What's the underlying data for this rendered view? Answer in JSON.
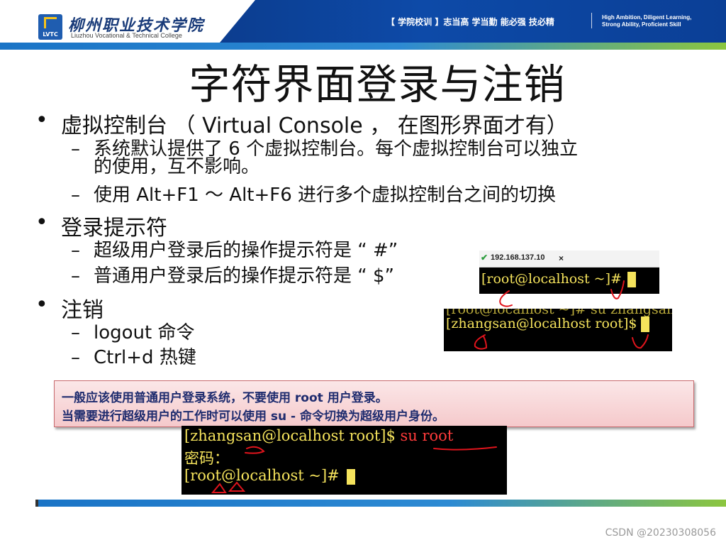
{
  "header": {
    "logo_text": "LVTC",
    "school_name_cn": "柳州职业技术学院",
    "school_name_en": "Liuzhou Vocational & Technical College",
    "motto_cn": "【 学院校训 】志当高  学当勤  能必强  技必精",
    "motto_en_line1": "High Ambition, Diligent Learning,",
    "motto_en_line2": "Strong Ability, Proficient Skill",
    "colors": {
      "banner": "#0c3d8f",
      "stripe_start": "#1a74c6",
      "stripe_end": "#8cc63f"
    }
  },
  "slide": {
    "title": "字符界面登录与注销",
    "bullets": [
      {
        "text": "虚拟控制台 （ Virtual Console ， 在图形界面才有）",
        "subs": [
          {
            "line1": "系统默认提供了 6 个虚拟控制台。每个虚拟控制台可以独立",
            "line2": "的使用，互不影响。"
          },
          {
            "line1": "使用 Alt+F1 ～ Alt+F6 进行多个虚拟控制台之间的切换"
          }
        ]
      },
      {
        "text": "登录提示符",
        "subs": [
          {
            "line1": "超级用户登录后的操作提示符是 “ #”"
          },
          {
            "line1": "普通用户登录后的操作提示符是 “ $”"
          }
        ]
      },
      {
        "text": "注销",
        "subs": [
          {
            "line1": "logout 命令"
          },
          {
            "line1": "Ctrl+d 热键"
          }
        ]
      }
    ],
    "bullet_glyph": "•",
    "dash_glyph": "–"
  },
  "terminal_tab": {
    "label": "192.168.137.10",
    "close": "×",
    "icon": "check-icon"
  },
  "terminal_root": {
    "prompt": "[root@localhost ~]#"
  },
  "terminal_user": {
    "ghost_line": "[root@localhost ~]# su zhangsan",
    "prompt": "[zhangsan@localhost root]$"
  },
  "note": {
    "line1": "一般应该使用普通用户登录系统，不要使用 root 用户登录。",
    "line2": "当需要进行超级用户的工作时可以使用  su -  命令切换为超级用户身份。"
  },
  "terminal_su": {
    "line1_prompt": "[zhangsan@localhost root]$",
    "line1_cmd": "su root",
    "line2": "密码：",
    "line3_prompt": "[root@localhost ~]#"
  },
  "watermark": "CSDN @20230308056"
}
